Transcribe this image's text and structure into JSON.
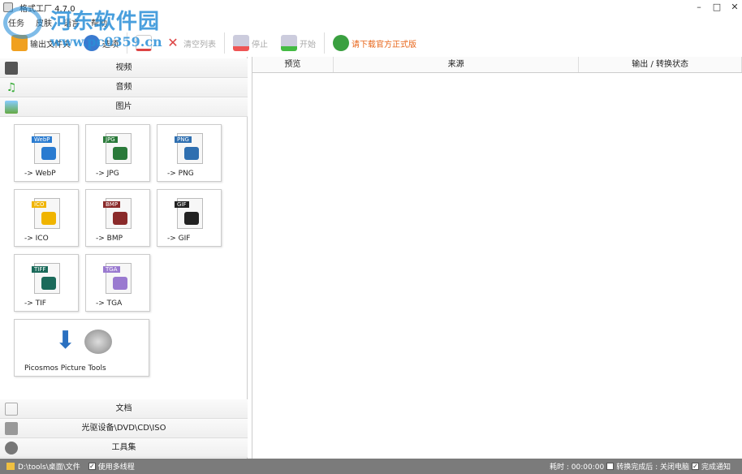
{
  "window": {
    "title": "格式工厂 4.7.0"
  },
  "watermark": {
    "name": "河东软件园",
    "url": "www.pc0359.cn"
  },
  "menu": [
    "任务",
    "皮肤",
    "语言",
    "帮助"
  ],
  "toolbar": {
    "output_folder": "输出文件夹",
    "options": "选项",
    "clear_list": "清空列表",
    "stop": "停止",
    "start": "开始",
    "download": "请下载官方正式版"
  },
  "categories_top": [
    "视频",
    "音频",
    "图片"
  ],
  "categories_bottom": [
    "文档",
    "光驱设备\\DVD\\CD\\ISO",
    "工具集"
  ],
  "tiles": [
    {
      "tag": "WebP",
      "label": "-> WebP",
      "color": "#2a7bd0"
    },
    {
      "tag": "JPG",
      "label": "-> JPG",
      "color": "#2a7a3a"
    },
    {
      "tag": "PNG",
      "label": "-> PNG",
      "color": "#2f6fb0"
    },
    {
      "tag": "ICO",
      "label": "-> ICO",
      "color": "#f0b400"
    },
    {
      "tag": "BMP",
      "label": "-> BMP",
      "color": "#8a2a2a"
    },
    {
      "tag": "GIF",
      "label": "-> GIF",
      "color": "#222222"
    },
    {
      "tag": "TIFF",
      "label": "-> TIF",
      "color": "#1a6a5a"
    },
    {
      "tag": "TGA",
      "label": "-> TGA",
      "color": "#9a7ad0"
    }
  ],
  "picture_tools": "Picosmos Picture Tools",
  "table": {
    "headers": [
      "预览",
      "来源",
      "输出 / 转换状态"
    ]
  },
  "status": {
    "path": "D:\\tools\\桌面\\文件",
    "multithread": "使用多线程",
    "multithread_checked": true,
    "elapsed": "耗时 : 00:00:00",
    "after_convert": "转换完成后 : 关闭电脑",
    "after_convert_checked": false,
    "notify": "完成通知",
    "notify_checked": true
  }
}
